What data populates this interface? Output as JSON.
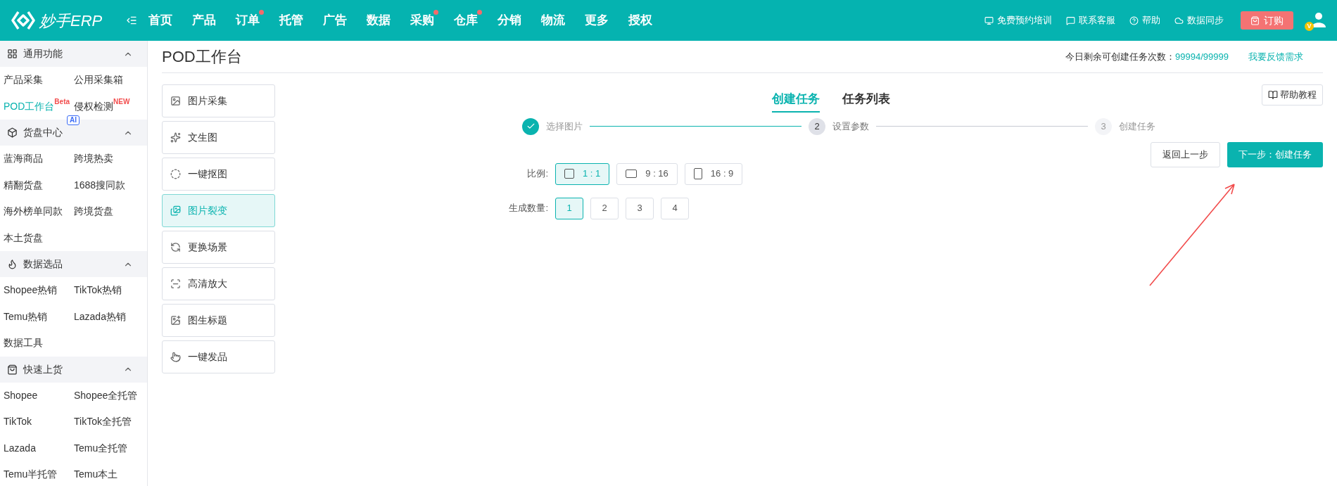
{
  "logo": {
    "text": "妙手ERP"
  },
  "nav": [
    {
      "label": "首页",
      "dot": false
    },
    {
      "label": "产品",
      "dot": false
    },
    {
      "label": "订单",
      "dot": true
    },
    {
      "label": "托管",
      "dot": false
    },
    {
      "label": "广告",
      "dot": false
    },
    {
      "label": "数据",
      "dot": false
    },
    {
      "label": "采购",
      "dot": true
    },
    {
      "label": "仓库",
      "dot": true
    },
    {
      "label": "分销",
      "dot": false
    },
    {
      "label": "物流",
      "dot": false
    },
    {
      "label": "更多",
      "dot": false
    },
    {
      "label": "授权",
      "dot": false
    }
  ],
  "header_links": [
    {
      "label": "免费预约培训",
      "kind": "training"
    },
    {
      "label": "联系客服",
      "kind": "service"
    },
    {
      "label": "帮助",
      "kind": "help"
    },
    {
      "label": "数据同步",
      "kind": "sync"
    }
  ],
  "order_button": "订购",
  "avatar_badge": "V",
  "sidebar": {
    "sections": [
      {
        "title": "通用功能",
        "kind": "grid",
        "expanded": true,
        "items": [
          {
            "label": "产品采集",
            "selected": false
          },
          {
            "label": "公用采集箱",
            "selected": false
          },
          {
            "label": "POD工作台",
            "selected": true,
            "badges": [
              {
                "text": "Beta",
                "kind": "red"
              }
            ]
          },
          {
            "label": "侵权检测",
            "selected": false,
            "badges": [
              {
                "text": "NEW",
                "kind": "red"
              },
              {
                "text": "AI",
                "kind": "ai"
              }
            ]
          }
        ]
      },
      {
        "title": "货盘中心",
        "kind": "cube",
        "expanded": true,
        "items": [
          {
            "label": "蓝海商品",
            "selected": false
          },
          {
            "label": "跨境热卖",
            "selected": false
          },
          {
            "label": "精翻货盘",
            "selected": false
          },
          {
            "label": "1688搜同款",
            "selected": false
          },
          {
            "label": "海外榜单同款",
            "selected": false
          },
          {
            "label": "跨境货盘",
            "selected": false
          },
          {
            "label": "本土货盘",
            "selected": false
          }
        ]
      },
      {
        "title": "数据选品",
        "kind": "fire",
        "expanded": true,
        "items": [
          {
            "label": "Shopee热销",
            "selected": false
          },
          {
            "label": "TikTok热销",
            "selected": false
          },
          {
            "label": "Temu热销",
            "selected": false
          },
          {
            "label": "Lazada热销",
            "selected": false
          },
          {
            "label": "数据工具",
            "selected": false
          }
        ]
      },
      {
        "title": "快速上货",
        "kind": "bag",
        "expanded": true,
        "items": [
          {
            "label": "Shopee",
            "selected": false
          },
          {
            "label": "Shopee全托管",
            "selected": false
          },
          {
            "label": "TikTok",
            "selected": false
          },
          {
            "label": "TikTok全托管",
            "selected": false
          },
          {
            "label": "Lazada",
            "selected": false
          },
          {
            "label": "Temu全托管",
            "selected": false
          },
          {
            "label": "Temu半托管",
            "selected": false
          },
          {
            "label": "Temu本土",
            "selected": false
          }
        ]
      }
    ]
  },
  "page": {
    "title": "POD工作台",
    "quota_label": "今日剩余可创建任务次数：",
    "quota_value": "99994/99999",
    "feedback_link": "我要反馈需求"
  },
  "tools": [
    {
      "label": "图片采集",
      "selected": false
    },
    {
      "label": "文生图",
      "selected": false
    },
    {
      "label": "一键抠图",
      "selected": false
    },
    {
      "label": "图片裂变",
      "selected": true
    },
    {
      "label": "更换场景",
      "selected": false
    },
    {
      "label": "高清放大",
      "selected": false
    },
    {
      "label": "图生标题",
      "selected": false
    },
    {
      "label": "一键发品",
      "selected": false
    }
  ],
  "tabs": [
    {
      "label": "创建任务",
      "selected": true
    },
    {
      "label": "任务列表",
      "selected": false
    }
  ],
  "help_button": "帮助教程",
  "steps": [
    {
      "label": "选择图片",
      "completed": true,
      "active": false
    },
    {
      "number": "2",
      "label": "设置参数",
      "completed": false,
      "active": true
    },
    {
      "number": "3",
      "label": "创建任务",
      "completed": false,
      "active": false
    }
  ],
  "buttons": {
    "back": "返回上一步",
    "next": "下一步：创建任务"
  },
  "form": {
    "ratio": {
      "label": "比例:",
      "options": [
        {
          "label": "1 : 1",
          "selected": true,
          "kind": "square"
        },
        {
          "label": "9 : 16",
          "selected": false,
          "kind": "wide"
        },
        {
          "label": "16 : 9",
          "selected": false,
          "kind": "tall"
        }
      ]
    },
    "count": {
      "label": "生成数量:",
      "options": [
        {
          "label": "1",
          "selected": true
        },
        {
          "label": "2",
          "selected": false
        },
        {
          "label": "3",
          "selected": false
        },
        {
          "label": "4",
          "selected": false
        }
      ]
    }
  }
}
